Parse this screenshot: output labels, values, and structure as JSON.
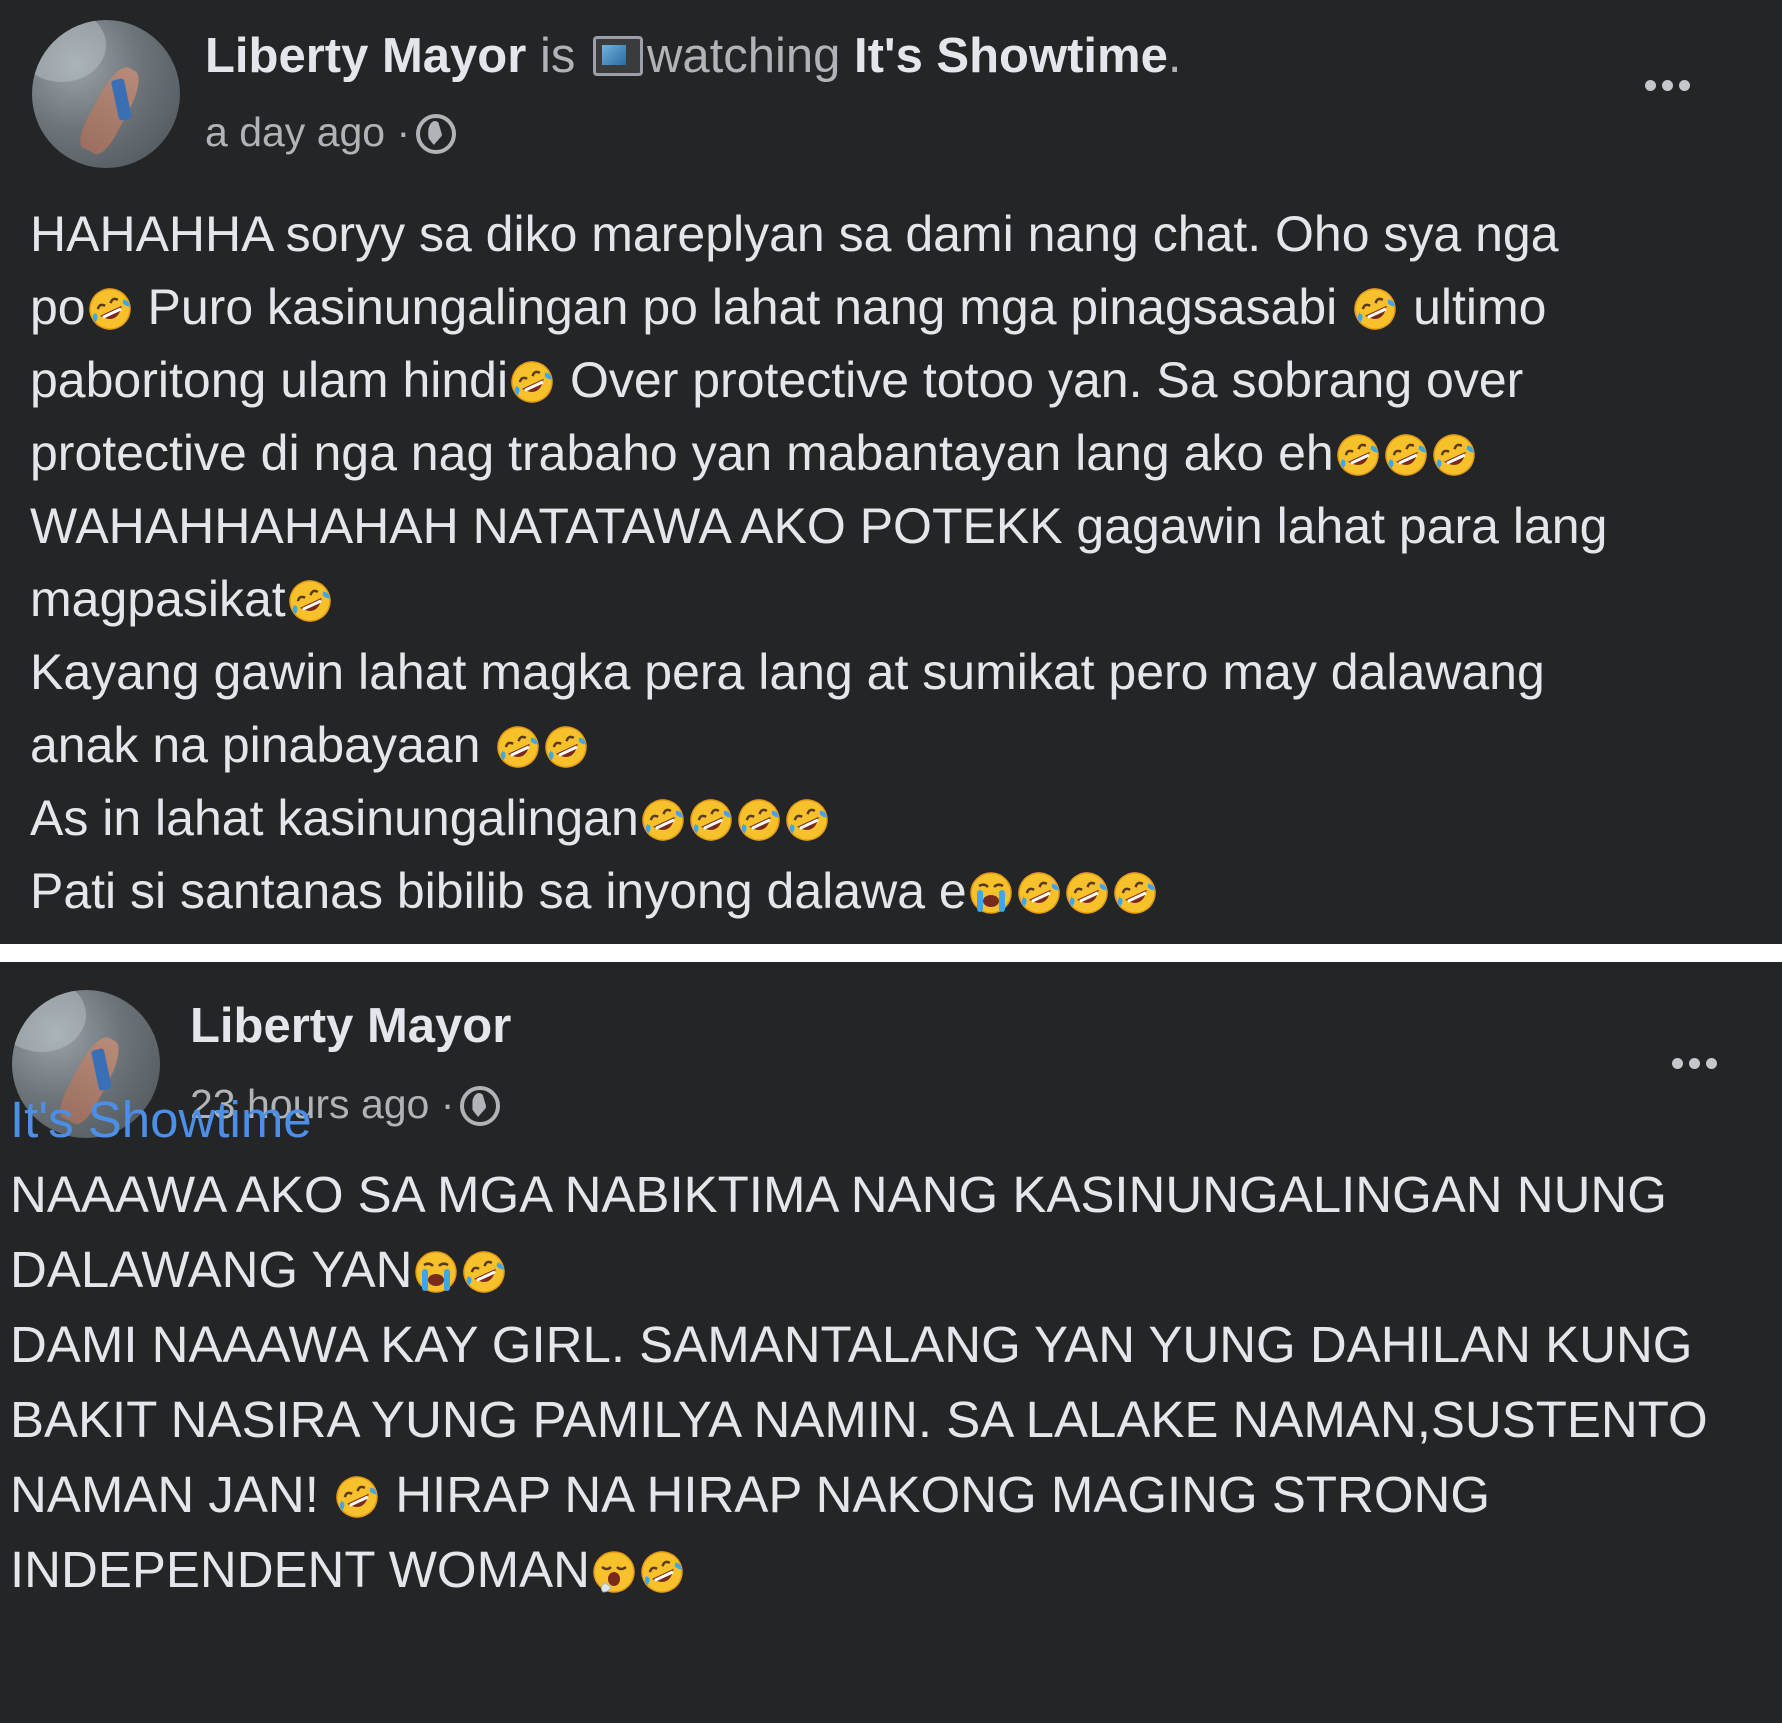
{
  "posts": [
    {
      "author": "Liberty Mayor",
      "activity_is": "is",
      "activity_icon": "tv-icon",
      "activity_verb": "watching",
      "activity_target": "It's Showtime",
      "activity_period": ".",
      "time": "a day ago",
      "separator": "·",
      "privacy_icon": "globe-icon",
      "lines": [
        [
          {
            "t": "HAHAHHA soryy sa diko mareplyan sa dami nang chat. Oho sya nga"
          }
        ],
        [
          {
            "t": "po"
          },
          {
            "e": "rofl"
          },
          {
            "t": " Puro kasinungalingan po lahat nang mga pinagsasabi "
          },
          {
            "e": "rofl"
          },
          {
            "t": " ultimo"
          }
        ],
        [
          {
            "t": "paboritong ulam hindi"
          },
          {
            "e": "rofl"
          },
          {
            "t": " Over protective totoo yan. Sa sobrang over"
          }
        ],
        [
          {
            "t": "protective di nga nag trabaho yan mabantayan lang ako eh"
          },
          {
            "e": "rofl"
          },
          {
            "e": "rofl"
          },
          {
            "e": "rofl"
          }
        ],
        [
          {
            "t": "WAHAHHAHAHAH NATATAWA AKO POTEKK gagawin lahat para lang"
          }
        ],
        [
          {
            "t": "magpasikat"
          },
          {
            "e": "rofl"
          }
        ],
        [
          {
            "t": "Kayang gawin lahat magka pera lang at sumikat pero may dalawang"
          }
        ],
        [
          {
            "t": "anak na pinabayaan "
          },
          {
            "e": "rofl"
          },
          {
            "e": "rofl"
          }
        ],
        [
          {
            "t": "As in lahat kasinungalingan"
          },
          {
            "e": "rofl"
          },
          {
            "e": "rofl"
          },
          {
            "e": "rofl"
          },
          {
            "e": "rofl"
          }
        ],
        [
          {
            "t": "Pati si santanas bibilib sa inyong dalawa e"
          },
          {
            "e": "cry"
          },
          {
            "e": "rofl"
          },
          {
            "e": "rofl"
          },
          {
            "e": "rofl"
          }
        ]
      ]
    },
    {
      "author": "Liberty Mayor",
      "time": "23 hours ago",
      "separator": "·",
      "privacy_icon": "globe-icon",
      "tag": "It's Showtime",
      "lines": [
        [
          {
            "t": "NAAAWA AKO SA MGA NABIKTIMA NANG KASINUNGALINGAN NUNG"
          }
        ],
        [
          {
            "t": "DALAWANG YAN"
          },
          {
            "e": "cry"
          },
          {
            "e": "rofl"
          }
        ],
        [
          {
            "t": "DAMI NAAAWA KAY GIRL. SAMANTALANG YAN YUNG DAHILAN KUNG"
          }
        ],
        [
          {
            "t": "BAKIT NASIRA YUNG PAMILYA NAMIN. SA LALAKE NAMAN,SUSTENTO"
          }
        ],
        [
          {
            "t": "NAMAN JAN! "
          },
          {
            "e": "rofl"
          },
          {
            "t": " HIRAP NA HIRAP NAKONG MAGING STRONG"
          }
        ],
        [
          {
            "t": "INDEPENDENT WOMAN"
          },
          {
            "e": "yawn"
          },
          {
            "e": "rofl"
          }
        ]
      ]
    }
  ],
  "colors": {
    "panel_bg": "#242526",
    "text_primary": "#e4e6eb",
    "text_secondary": "#b0b3b8",
    "link": "#4b8fe8"
  }
}
